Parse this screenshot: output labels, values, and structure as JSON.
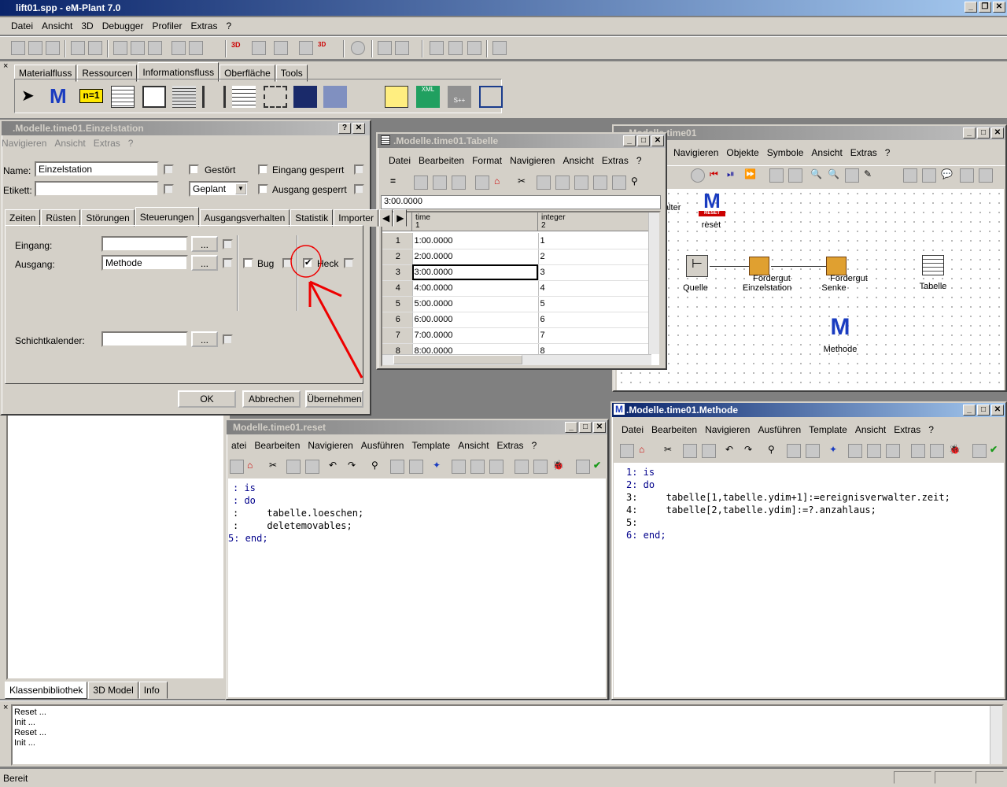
{
  "app": {
    "title": "lift01.spp - eM-Plant 7.0"
  },
  "main_menu": [
    "Datei",
    "Ansicht",
    "3D",
    "Debugger",
    "Profiler",
    "Extras",
    "?"
  ],
  "object_tabs": [
    "Materialfluss",
    "Ressourcen",
    "Informationsfluss",
    "Oberfläche",
    "Tools"
  ],
  "object_tabs_active": "Informationsfluss",
  "einzel": {
    "title": ".Modelle.time01.Einzelstation",
    "menu": [
      "Navigieren",
      "Ansicht",
      "Extras",
      "?"
    ],
    "name_label": "Name:",
    "name_value": "Einzelstation",
    "etikett_label": "Etikett:",
    "etikett_value": "",
    "gestoert": "Gestört",
    "eingang_gesperrt": "Eingang gesperrt",
    "ausgang_gesperrt": "Ausgang gesperrt",
    "state_value": "Geplant",
    "tabs": [
      "Zeiten",
      "Rüsten",
      "Störungen",
      "Steuerungen",
      "Ausgangsverhalten",
      "Statistik",
      "Importer"
    ],
    "active_tab": "Steuerungen",
    "eingang_label": "Eingang:",
    "eingang_value": "",
    "ausgang_label": "Ausgang:",
    "ausgang_value": "Methode",
    "bug_label": "Bug",
    "heck_label": "Heck",
    "heck_checked": "✔",
    "schicht_label": "Schichtkalender:",
    "schicht_value": "",
    "dots": "...",
    "ok": "OK",
    "abbrechen": "Abbrechen",
    "uebernehmen": "Übernehmen"
  },
  "tabelle": {
    "title": ".Modelle.time01.Tabelle",
    "menu": [
      "Datei",
      "Bearbeiten",
      "Format",
      "Navigieren",
      "Ansicht",
      "Extras",
      "?"
    ],
    "cell_value": "3:00.0000",
    "col1_header": "time",
    "col1_num": "1",
    "col2_header": "integer",
    "col2_num": "2",
    "rows": [
      {
        "n": "1",
        "time": "1:00.0000",
        "int": "1"
      },
      {
        "n": "2",
        "time": "2:00.0000",
        "int": "2"
      },
      {
        "n": "3",
        "time": "3:00.0000",
        "int": "3"
      },
      {
        "n": "4",
        "time": "4:00.0000",
        "int": "4"
      },
      {
        "n": "5",
        "time": "5:00.0000",
        "int": "5"
      },
      {
        "n": "6",
        "time": "6:00.0000",
        "int": "6"
      },
      {
        "n": "7",
        "time": "7:00.0000",
        "int": "7"
      },
      {
        "n": "8",
        "time": "8:00.0000",
        "int": "8"
      }
    ]
  },
  "frame": {
    "title": ".Modelle.time01",
    "menu": [
      "Navigieren",
      "Objekte",
      "Symbole",
      "Ansicht",
      "Extras",
      "?"
    ],
    "partial_label": "alter",
    "nodes": {
      "reset": "reset",
      "quelle": "Quelle",
      "einzel_top": "Fördergut",
      "einzel": "Einzelstation",
      "senke_top": "Fördergut",
      "senke": "Senke",
      "tabelle": "Tabelle",
      "methode": "Methode"
    }
  },
  "reset": {
    "title": "Modelle.time01.reset",
    "menu": [
      "atei",
      "Bearbeiten",
      "Navigieren",
      "Ausführen",
      "Template",
      "Ansicht",
      "Extras",
      "?"
    ],
    "code": [
      ": is",
      ": do",
      ":     tabelle.loeschen;",
      ":     deletemovables;",
      "5: end;"
    ]
  },
  "methode": {
    "title": ".Modelle.time01.Methode",
    "menu": [
      "Datei",
      "Bearbeiten",
      "Navigieren",
      "Ausführen",
      "Template",
      "Ansicht",
      "Extras",
      "?"
    ],
    "code": [
      "1: is",
      "2: do",
      "3:     tabelle[1,tabelle.ydim+1]:=ereignisverwalter.zeit;",
      "4:     tabelle[2,tabelle.ydim]:=?.anzahlaus;",
      "5:",
      "6: end;"
    ]
  },
  "library_tabs": [
    "Klassenbibliothek",
    "3D Model",
    "Info"
  ],
  "console": [
    "Reset ...",
    "Init ...",
    "Reset ...",
    "Init ..."
  ],
  "status": "Bereit"
}
